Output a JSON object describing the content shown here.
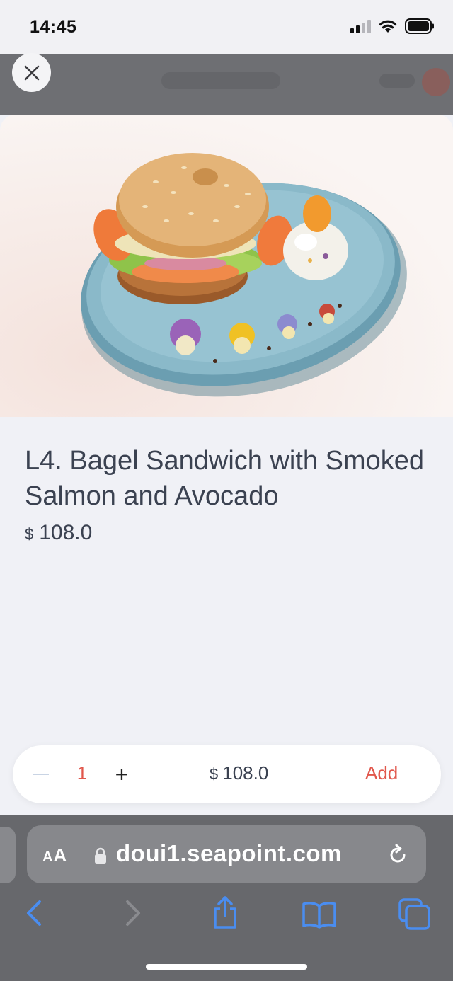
{
  "status_bar": {
    "time": "14:45",
    "icons": [
      "cellular-signal-icon",
      "wifi-icon",
      "battery-icon"
    ]
  },
  "modal": {
    "close_icon": "close-icon",
    "image_alt": "Bagel sandwich with smoked salmon and avocado on a blue plate",
    "title": "L4. Bagel Sandwich with Smoked Salmon and Avocado",
    "price_currency": "$",
    "price_value": "108.0"
  },
  "order_bar": {
    "minus_icon": "minus-icon",
    "quantity": "1",
    "plus_label": "+",
    "total_currency": "$",
    "total_value": "108.0",
    "add_label": "Add"
  },
  "browser": {
    "aa_label": "A",
    "aa_label_big": "A",
    "url": "doui1.seapoint.com",
    "toolbar_icons": [
      "back-icon",
      "forward-icon",
      "share-icon",
      "bookmarks-icon",
      "tabs-icon"
    ]
  },
  "colors": {
    "accent": "#e1574c",
    "text": "#3b4251",
    "link_blue": "#4a8df0"
  }
}
